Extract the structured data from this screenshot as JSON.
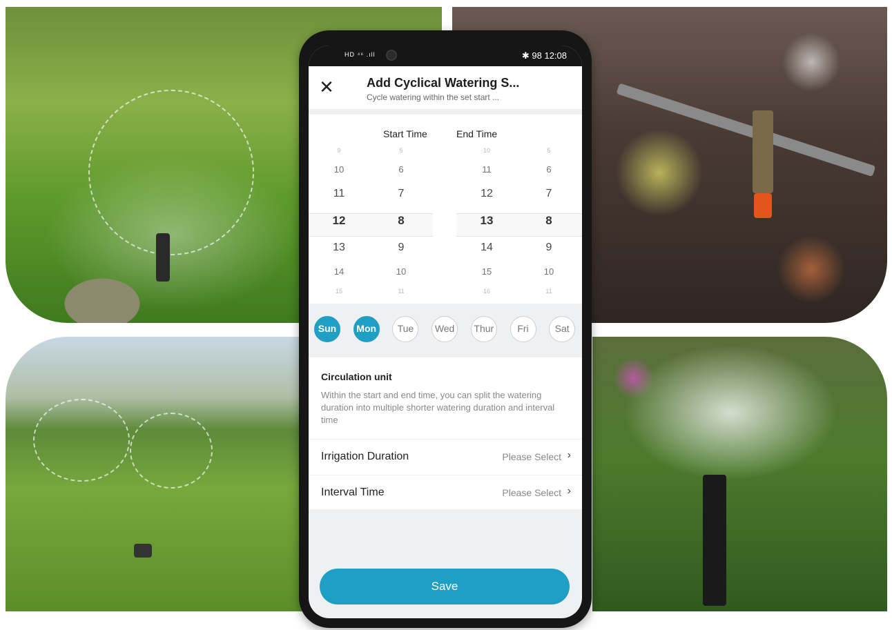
{
  "statusbar": {
    "left": "HD ⁴⁶ .ıll",
    "right": "✱ 98 12:08"
  },
  "header": {
    "title": "Add Cyclical Watering S...",
    "subtitle": "Cycle watering within the set start ..."
  },
  "picker": {
    "start_label": "Start Time",
    "end_label": "End Time",
    "start_hours": [
      "9",
      "10",
      "11",
      "12",
      "13",
      "14",
      "15"
    ],
    "start_minutes": [
      "5",
      "6",
      "7",
      "8",
      "9",
      "10",
      "11"
    ],
    "end_hours": [
      "10",
      "11",
      "12",
      "13",
      "14",
      "15",
      "16"
    ],
    "end_minutes": [
      "5",
      "6",
      "7",
      "8",
      "9",
      "10",
      "11"
    ],
    "selected_start": "12:8",
    "selected_end": "13:8"
  },
  "days": [
    {
      "label": "Sun",
      "selected": true
    },
    {
      "label": "Mon",
      "selected": true
    },
    {
      "label": "Tue",
      "selected": false
    },
    {
      "label": "Wed",
      "selected": false
    },
    {
      "label": "Thur",
      "selected": false
    },
    {
      "label": "Fri",
      "selected": false
    },
    {
      "label": "Sat",
      "selected": false
    }
  ],
  "circulation": {
    "title": "Circulation unit",
    "description": "Within the start and end time, you can split the watering duration into multiple shorter watering duration and interval time",
    "rows": [
      {
        "label": "Irrigation Duration",
        "value": "Please Select"
      },
      {
        "label": "Interval Time",
        "value": "Please Select"
      }
    ]
  },
  "save_label": "Save",
  "colors": {
    "accent": "#1f9fc3"
  },
  "icons": {
    "close": "close-icon",
    "chevron": "chevron-right-icon"
  }
}
